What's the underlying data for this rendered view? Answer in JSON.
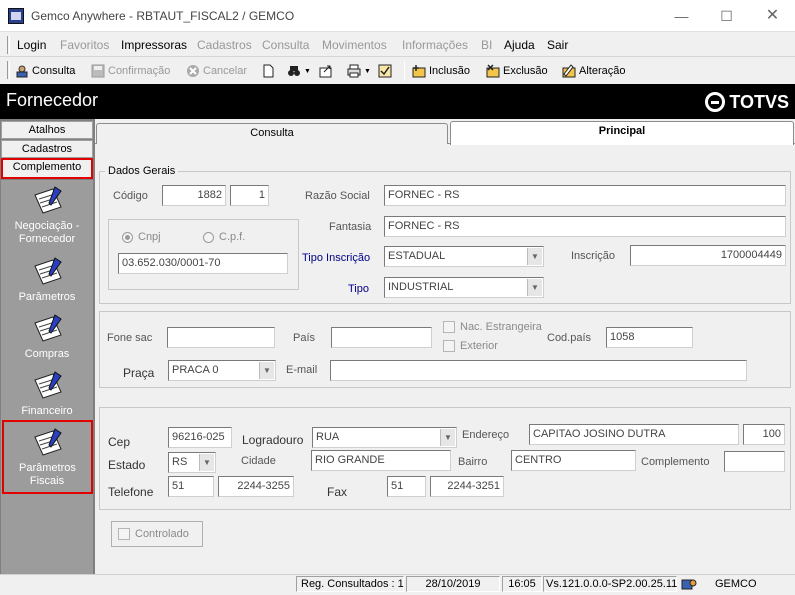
{
  "window": {
    "title": "Gemco Anywhere - RBTAUT_FISCAL2 / GEMCO",
    "min_icon": "minimize-icon",
    "max_icon": "maximize-icon",
    "close_icon": "close-icon"
  },
  "menu": [
    "Login",
    "Favoritos",
    "Impressoras",
    "Cadastros",
    "Consulta",
    "Movimentos",
    "Informações",
    "BI",
    "Ajuda",
    "Sair"
  ],
  "toolbar": {
    "consulta": "Consulta",
    "confirmacao": "Confirmação",
    "cancelar": "Cancelar",
    "inclusao": "Inclusão",
    "exclusao": "Exclusão",
    "alteracao": "Alteração"
  },
  "header": {
    "title": "Fornecedor",
    "logo": "TOTVS"
  },
  "sidebar": {
    "buttons": [
      "Atalhos",
      "Cadastros",
      "Complemento"
    ],
    "items": [
      {
        "label": "Negociação - Fornecedor",
        "icon": "notepad-icon"
      },
      {
        "label": "Parâmetros",
        "icon": "notepad-icon"
      },
      {
        "label": "Compras",
        "icon": "notepad-icon"
      },
      {
        "label": "Financeiro",
        "icon": "notepad-icon"
      },
      {
        "label": "Parâmetros Fiscais",
        "icon": "notepad-icon"
      }
    ]
  },
  "tabs": [
    "Consulta",
    "Principal"
  ],
  "dados_gerais": {
    "legend": "Dados Gerais",
    "codigo_label": "Código",
    "codigo": "1882",
    "codigo_dv": "1",
    "razao_label": "Razão Social",
    "razao": "FORNEC - RS",
    "fantasia_label": "Fantasia",
    "fantasia": "FORNEC - RS",
    "cnpj_label": "Cnpj",
    "cpf_label": "C.p.f.",
    "documento": "03.652.030/0001-70",
    "tipo_inscricao_label": "Tipo Inscrição",
    "tipo_inscricao": "ESTADUAL",
    "inscricao_label": "Inscrição",
    "inscricao": "1700004449",
    "tipo_label": "Tipo",
    "tipo": "INDUSTRIAL"
  },
  "contato": {
    "fone_label": "Fone sac",
    "fone": "",
    "pais_label": "País",
    "pais": "",
    "nac_estrangeira_label": "Nac. Estrangeira",
    "exterior_label": "Exterior",
    "codpais_label": "Cod.país",
    "codpais": "1058",
    "praca_label": "Praça",
    "praca": "PRACA 0",
    "email_label": "E-mail",
    "email": ""
  },
  "endereco": {
    "cep_label": "Cep",
    "cep": "96216-025",
    "logradouro_label": "Logradouro",
    "logradouro": "RUA",
    "endereco_label": "Endereço",
    "endereco": "CAPITAO JOSINO DUTRA",
    "numero": "100",
    "estado_label": "Estado",
    "estado": "RS",
    "cidade_label": "Cidade",
    "cidade": "RIO GRANDE",
    "bairro_label": "Bairro",
    "bairro": "CENTRO",
    "complemento_label": "Complemento",
    "complemento": "",
    "telefone_label": "Telefone",
    "tel_ddd": "51",
    "tel_num": "2244-3255",
    "fax_label": "Fax",
    "fax_ddd": "51",
    "fax_num": "2244-3251"
  },
  "controlado_label": "Controlado",
  "status": {
    "reg": "Reg. Consultados : 1",
    "date": "28/10/2019",
    "time": "16:05",
    "version": "Vs.121.0.0.0-SP2.00.25.11",
    "company": "GEMCO"
  },
  "colors": {
    "header_bg": "#000000",
    "highlight": "#e00000",
    "sidebar_bg": "#808080",
    "label_blue": "#00008b"
  }
}
